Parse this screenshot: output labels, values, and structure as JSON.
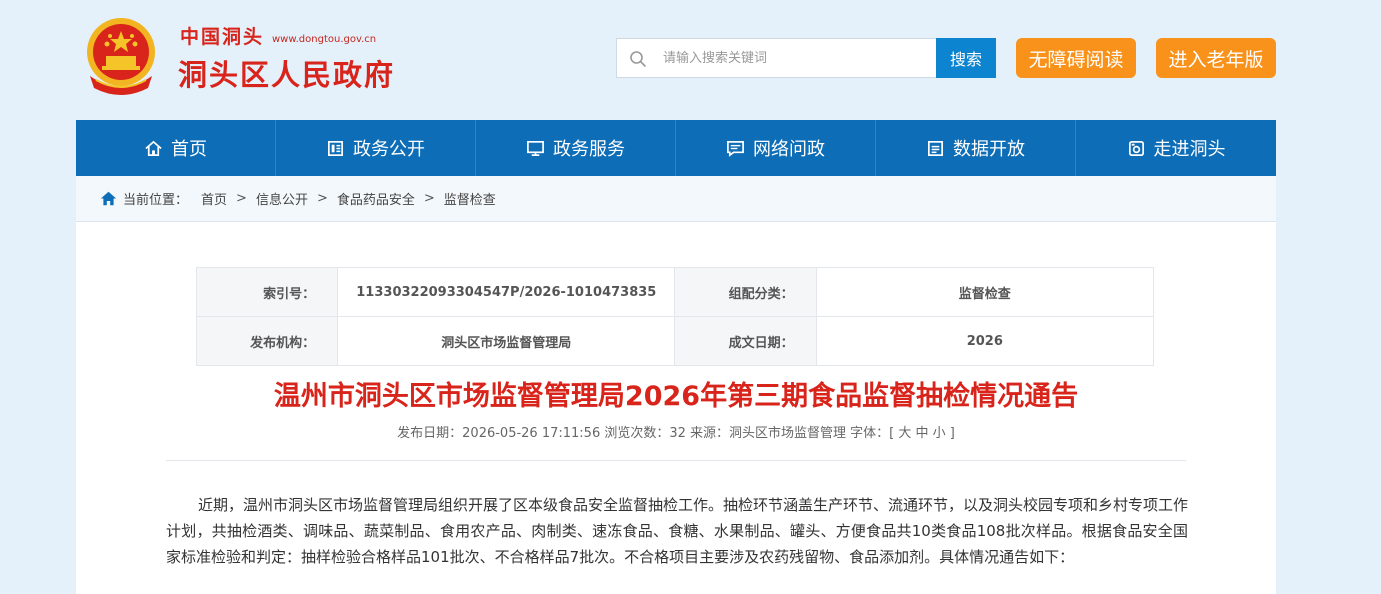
{
  "header": {
    "logo_cn": "中国洞头",
    "logo_url": "www.dongtou.gov.cn",
    "site_title": "洞头区人民政府",
    "search_placeholder": "请输入搜索关键词",
    "search_button": "搜索",
    "accessible_button": "无障碍阅读",
    "elder_button": "进入老年版"
  },
  "nav": {
    "items": [
      {
        "label": "首页",
        "icon": "home-icon"
      },
      {
        "label": "政务公开",
        "icon": "document-icon"
      },
      {
        "label": "政务服务",
        "icon": "monitor-icon"
      },
      {
        "label": "网络问政",
        "icon": "message-icon"
      },
      {
        "label": "数据开放",
        "icon": "data-icon"
      },
      {
        "label": "走进洞头",
        "icon": "camera-icon"
      }
    ]
  },
  "breadcrumb": {
    "prefix": "当前位置：",
    "items": [
      "首页",
      "信息公开",
      "食品药品安全",
      "监督检查"
    ],
    "separator": ">"
  },
  "meta": {
    "index_label": "索引号：",
    "index_value": "11330322093304547P/2026-1010473835",
    "category_label": "组配分类：",
    "category_value": "监督检查",
    "publisher_label": "发布机构：",
    "publisher_value": "洞头区市场监督管理局",
    "date_label": "成文日期：",
    "date_value": "2026"
  },
  "article": {
    "title": "温州市洞头区市场监督管理局2026年第三期食品监督抽检情况通告",
    "subline": "发布日期：2026-05-26 17:11:56 浏览次数：32 来源：洞头区市场监督管理 字体：[ 大 中 小 ]",
    "paragraph": "近期，温州市洞头区市场监督管理局组织开展了区本级食品安全监督抽检工作。抽检环节涵盖生产环节、流通环节，以及洞头校园专项和乡村专项工作计划，共抽检酒类、调味品、蔬菜制品、食用农产品、肉制类、速冻食品、食糖、水果制品、罐头、方便食品共10类食品108批次样品。根据食品安全国家标准检验和判定：抽样检验合格样品101批次、不合格样品7批次。不合格项目主要涉及农药残留物、食品添加剂。具体情况通告如下："
  },
  "colors": {
    "nav_blue": "#0d6db7",
    "search_blue": "#0d84d0",
    "orange": "#f8921b",
    "title_red": "#d8241a",
    "page_bg": "#e4f1fb"
  }
}
